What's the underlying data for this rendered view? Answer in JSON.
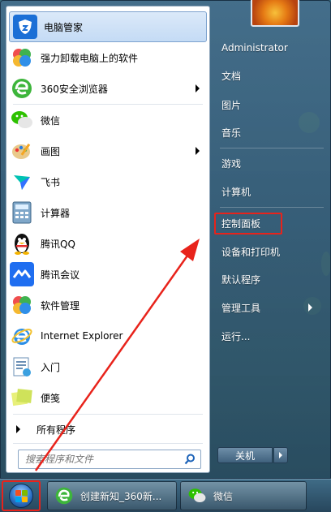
{
  "programs": [
    {
      "label": "电脑管家",
      "icon": "tencent-pc-manager-icon",
      "highlight": true,
      "submenu": false
    },
    {
      "label": "强力卸载电脑上的软件",
      "icon": "uninstaller-icon",
      "submenu": false
    },
    {
      "label": "360安全浏览器",
      "icon": "360-browser-icon",
      "submenu": true
    },
    {
      "label": "微信",
      "icon": "wechat-icon",
      "submenu": false
    },
    {
      "label": "画图",
      "icon": "paint-icon",
      "submenu": true
    },
    {
      "label": "飞书",
      "icon": "feishu-icon",
      "submenu": false
    },
    {
      "label": "计算器",
      "icon": "calculator-icon",
      "submenu": false
    },
    {
      "label": "腾讯QQ",
      "icon": "qq-penguin-icon",
      "submenu": false
    },
    {
      "label": "腾讯会议",
      "icon": "tencent-meeting-icon",
      "submenu": false
    },
    {
      "label": "软件管理",
      "icon": "software-manager-icon",
      "submenu": false
    },
    {
      "label": "Internet Explorer",
      "icon": "internet-explorer-icon",
      "submenu": false
    },
    {
      "label": "入门",
      "icon": "getting-started-icon",
      "submenu": false
    },
    {
      "label": "便笺",
      "icon": "sticky-notes-icon",
      "submenu": false
    }
  ],
  "all_programs": "所有程序",
  "search": {
    "placeholder": "搜索程序和文件"
  },
  "right_panel": {
    "user": "Administrator",
    "items": [
      {
        "label": "文档"
      },
      {
        "label": "图片"
      },
      {
        "label": "音乐"
      },
      {
        "label": "游戏"
      },
      {
        "label": "计算机"
      },
      {
        "label": "控制面板"
      },
      {
        "label": "设备和打印机"
      },
      {
        "label": "默认程序"
      },
      {
        "label": "管理工具",
        "submenu": true
      },
      {
        "label": "运行..."
      }
    ],
    "shutdown": "关机"
  },
  "taskbar": {
    "items": [
      {
        "label": "创建新知_360新...",
        "icon": "360-browser-icon"
      },
      {
        "label": "微信",
        "icon": "wechat-icon"
      }
    ]
  },
  "colors": {
    "annotation": "#e8231b",
    "highlight": "#c4dbf5"
  }
}
